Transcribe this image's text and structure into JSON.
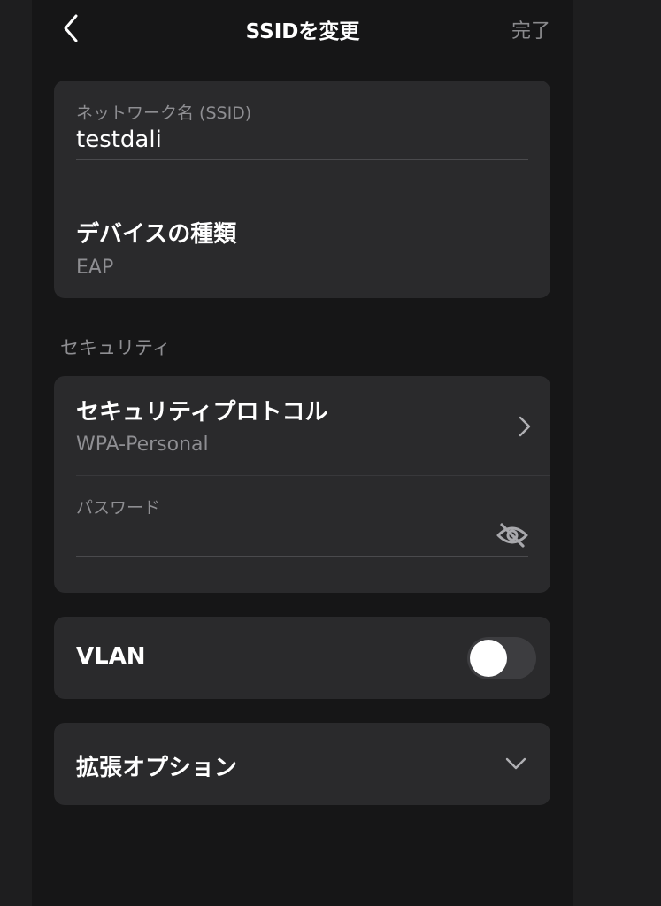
{
  "header": {
    "title": "SSIDを変更",
    "done_label": "完了"
  },
  "network": {
    "ssid_label": "ネットワーク名 (SSID)",
    "ssid_value": "testdali",
    "device_type_label": "デバイスの種類",
    "device_type_value": "EAP"
  },
  "security": {
    "section_label": "セキュリティ",
    "protocol_label": "セキュリティプロトコル",
    "protocol_value": "WPA-Personal",
    "password_label": "パスワード",
    "password_value": ""
  },
  "vlan": {
    "label": "VLAN",
    "enabled": false
  },
  "advanced": {
    "label": "拡張オプション"
  },
  "icons": {
    "back": "chevron-left-icon",
    "protocol_chevron": "chevron-right-icon",
    "password_visibility": "eye-off-icon",
    "advanced_chevron": "chevron-down-icon"
  },
  "colors": {
    "background": "#161617",
    "card": "#2a2a2c",
    "secondary_text": "#8e8e92",
    "toggle_off": "#3d3d40"
  }
}
